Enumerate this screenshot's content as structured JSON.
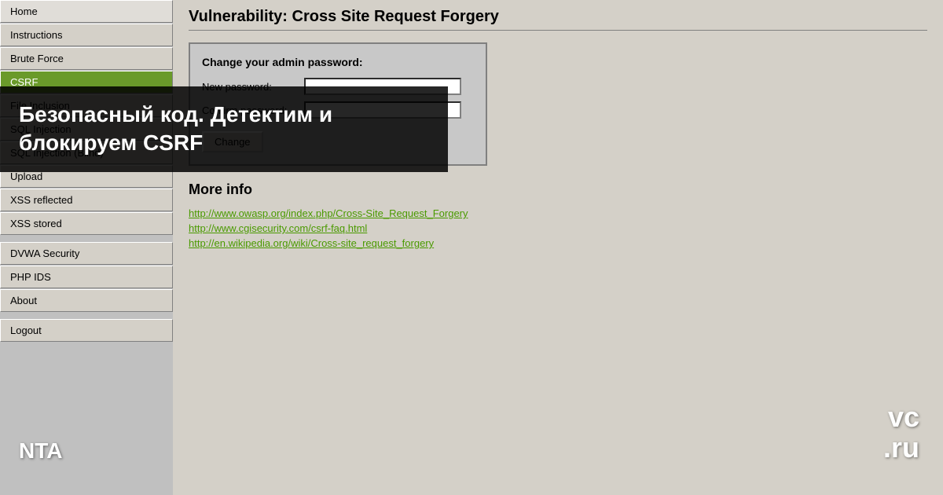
{
  "page": {
    "title": "Vulnerability: Cross Site Request Forgery",
    "background_color": "#c0c0c0"
  },
  "sidebar": {
    "items": [
      {
        "id": "home",
        "label": "Home",
        "active": false
      },
      {
        "id": "instructions",
        "label": "Instructions",
        "active": false
      },
      {
        "id": "brute-force",
        "label": "Brute Force",
        "active": false
      },
      {
        "id": "csrf",
        "label": "CSRF",
        "active": true
      },
      {
        "id": "file-inclusion",
        "label": "File Inclusion",
        "active": false
      },
      {
        "id": "sql-injection",
        "label": "SQL Injection",
        "active": false
      },
      {
        "id": "sql-injection-blind",
        "label": "SQL Injection (Blind)",
        "active": false
      },
      {
        "id": "upload",
        "label": "Upload",
        "active": false
      },
      {
        "id": "xss-reflected",
        "label": "XSS reflected",
        "active": false
      },
      {
        "id": "xss-stored",
        "label": "XSS stored",
        "active": false
      },
      {
        "id": "dvwa-security",
        "label": "DVWA Security",
        "active": false
      },
      {
        "id": "php-ids",
        "label": "PHP IDS",
        "active": false
      },
      {
        "id": "about",
        "label": "About",
        "active": false
      },
      {
        "id": "logout",
        "label": "Logout",
        "active": false
      }
    ]
  },
  "password_form": {
    "title": "Change your admin password:",
    "new_password_label": "New password:",
    "confirm_password_label": "Confirm password:",
    "new_password_value": "",
    "confirm_password_value": "",
    "change_button_label": "Change"
  },
  "more_info": {
    "title": "More info",
    "links": [
      {
        "id": "link1",
        "text": "http://www.owasp.org/index.php/Cross-Site_Request_Forgery",
        "url": "#"
      },
      {
        "id": "link2",
        "text": "http://www.cgisecurity.com/csrf-faq.html",
        "url": "#"
      },
      {
        "id": "link3",
        "text": "http://en.wikipedia.org/wiki/Cross-site_request_forgery",
        "url": "#"
      }
    ]
  },
  "overlay": {
    "title": "Безопасный код. Детектим и блокируем CSRF"
  },
  "badges": {
    "vcru": "vc\n.ru",
    "nta": "NTA"
  }
}
